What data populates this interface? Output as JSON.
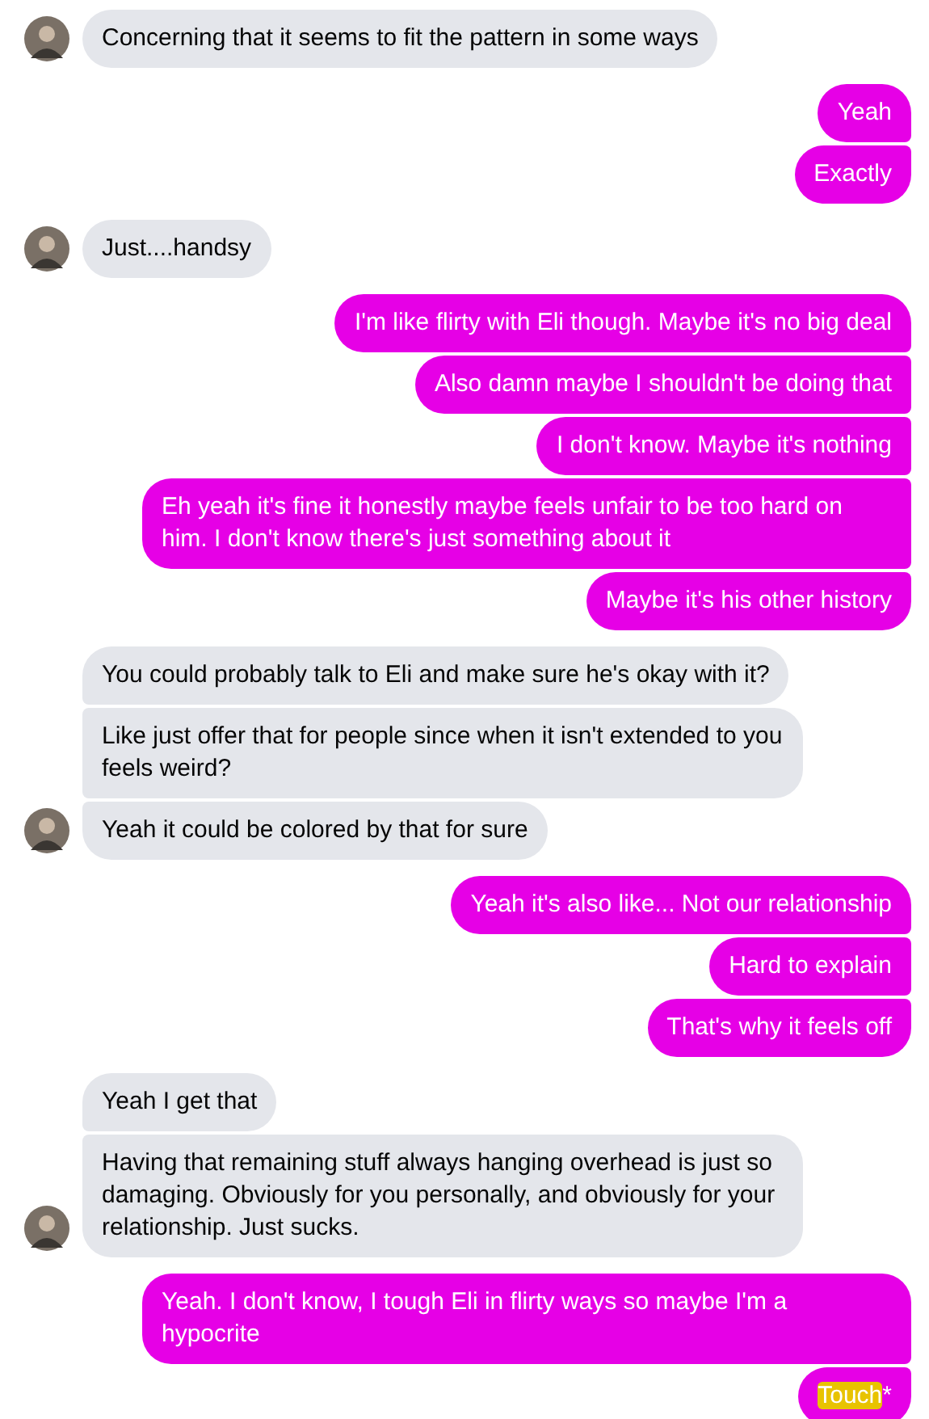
{
  "groups": [
    {
      "outgoing": false,
      "messages": [
        [
          {
            "text": "Concerning that it seems to fit the pattern in some ways",
            "highlighted": false
          }
        ]
      ]
    },
    {
      "outgoing": true,
      "messages": [
        [
          {
            "text": "Yeah",
            "highlighted": false
          }
        ],
        [
          {
            "text": "Exactly",
            "highlighted": false
          }
        ]
      ]
    },
    {
      "outgoing": false,
      "messages": [
        [
          {
            "text": "Just....handsy",
            "highlighted": false
          }
        ]
      ]
    },
    {
      "outgoing": true,
      "messages": [
        [
          {
            "text": "I'm like flirty with Eli though. Maybe it's no big deal",
            "highlighted": false
          }
        ],
        [
          {
            "text": "Also damn maybe I shouldn't be doing that",
            "highlighted": false
          }
        ],
        [
          {
            "text": "I don't know. Maybe it's nothing",
            "highlighted": false
          }
        ],
        [
          {
            "text": "Eh yeah it's fine it honestly maybe feels unfair to be too hard on him. I don't know there's just something about it",
            "highlighted": false
          }
        ],
        [
          {
            "text": "Maybe it's his other history",
            "highlighted": false
          }
        ]
      ]
    },
    {
      "outgoing": false,
      "messages": [
        [
          {
            "text": "You could probably talk to Eli and make sure he's okay with it?",
            "highlighted": false
          }
        ],
        [
          {
            "text": "Like just offer that for people since when it isn't extended to you feels weird?",
            "highlighted": false
          }
        ],
        [
          {
            "text": "Yeah it could be colored by that for sure",
            "highlighted": false
          }
        ]
      ]
    },
    {
      "outgoing": true,
      "messages": [
        [
          {
            "text": "Yeah it's also like... Not our relationship",
            "highlighted": false
          }
        ],
        [
          {
            "text": "Hard to explain",
            "highlighted": false
          }
        ],
        [
          {
            "text": "That's why it feels off",
            "highlighted": false
          }
        ]
      ]
    },
    {
      "outgoing": false,
      "messages": [
        [
          {
            "text": "Yeah I get that",
            "highlighted": false
          }
        ],
        [
          {
            "text": "Having that remaining stuff always hanging overhead is just so damaging. Obviously for you personally, and obviously for your relationship. Just sucks.",
            "highlighted": false
          }
        ]
      ]
    },
    {
      "outgoing": true,
      "messages": [
        [
          {
            "text": "Yeah. I don't know, I tough Eli in flirty ways so maybe I'm a hypocrite",
            "highlighted": false
          }
        ],
        [
          {
            "text": "Touch",
            "highlighted": true
          },
          {
            "text": "*",
            "highlighted": false
          }
        ]
      ]
    }
  ]
}
